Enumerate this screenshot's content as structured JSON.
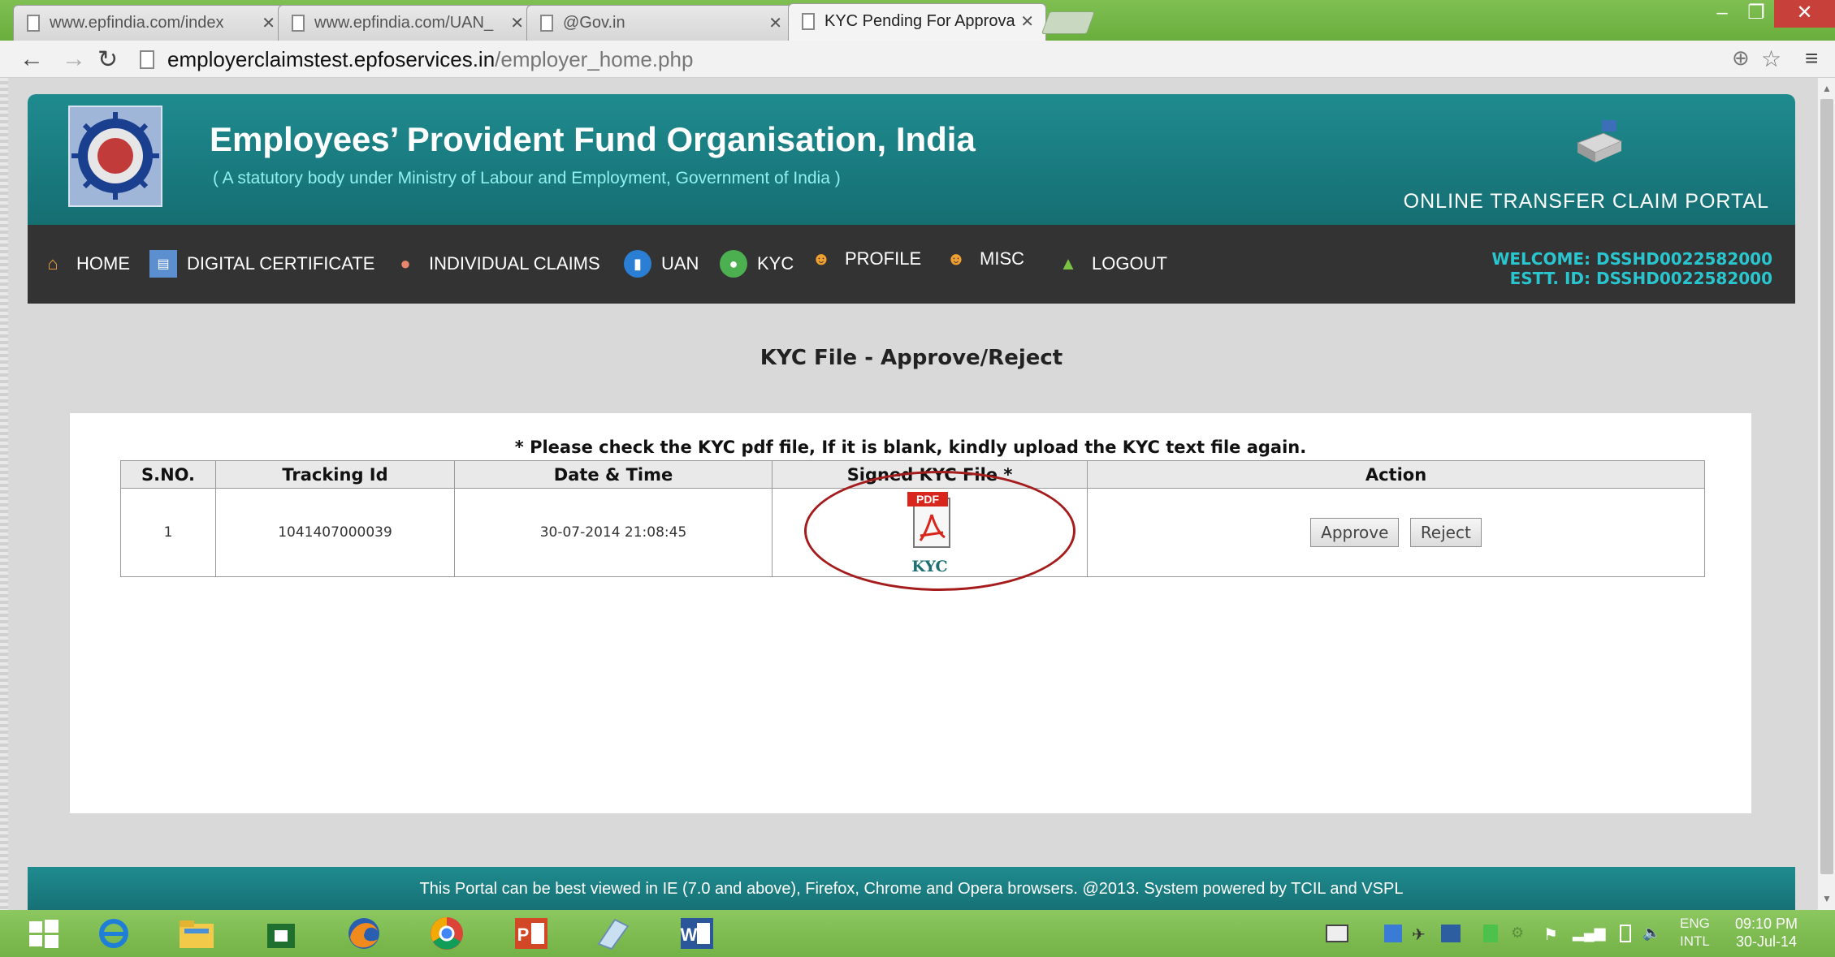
{
  "browser": {
    "tabs": [
      {
        "title": "www.epfindia.com/index",
        "active": false
      },
      {
        "title": "www.epfindia.com/UAN_",
        "active": false
      },
      {
        "title": "@Gov.in",
        "active": false
      },
      {
        "title": "KYC Pending For Approva",
        "active": true
      }
    ],
    "url_host": "employerclaimstest.epfoservices.in",
    "url_path": "/employer_home.php"
  },
  "header": {
    "title": "Employees’ Provident Fund Organisation, India",
    "subtitle": "( A statutory body under Ministry of Labour and Employment, Government of India )",
    "portal_name": "ONLINE TRANSFER CLAIM PORTAL"
  },
  "nav": {
    "items": [
      {
        "label": "HOME",
        "icon": "home-icon"
      },
      {
        "label": "DIGITAL CERTIFICATE",
        "icon": "certificate-icon"
      },
      {
        "label": "INDIVIDUAL CLAIMS",
        "icon": "person-icon"
      },
      {
        "label": "UAN",
        "icon": "document-icon"
      },
      {
        "label": "KYC",
        "icon": "user-circle-icon"
      },
      {
        "label": "PROFILE",
        "icon": "people-icon"
      },
      {
        "label": "MISC",
        "icon": "people-icon"
      },
      {
        "label": "LOGOUT",
        "icon": "arrow-up-icon"
      }
    ],
    "welcome": "WELCOME: DSSHD0022582000",
    "estt_id": "ESTT. ID: DSSHD0022582000"
  },
  "main": {
    "heading": "KYC File - Approve/Reject",
    "notice": "* Please check the KYC pdf file, If it is blank, kindly upload the KYC text file again.",
    "table": {
      "headers": [
        "S.NO.",
        "Tracking Id",
        "Date & Time",
        "Signed KYC File *",
        "Action"
      ],
      "rows": [
        {
          "sno": "1",
          "tracking_id": "1041407000039",
          "datetime": "30-07-2014 21:08:45",
          "file_label": "KYC",
          "pdf_badge": "PDF"
        }
      ],
      "approve_label": "Approve",
      "reject_label": "Reject"
    }
  },
  "footer": {
    "text": "This Portal can be best viewed in IE (7.0 and above), Firefox, Chrome and Opera browsers.      @2013. System powered by TCIL and VSPL"
  },
  "taskbar": {
    "lang": "ENG",
    "lang_sub": "INTL",
    "time": "09:10 PM",
    "date": "30-Jul-14"
  },
  "colors": {
    "header_teal": "#1f8b8f",
    "nav_dark": "#333333",
    "welcome_cyan": "#2ac6cf",
    "highlight_red": "#a51c1c"
  }
}
